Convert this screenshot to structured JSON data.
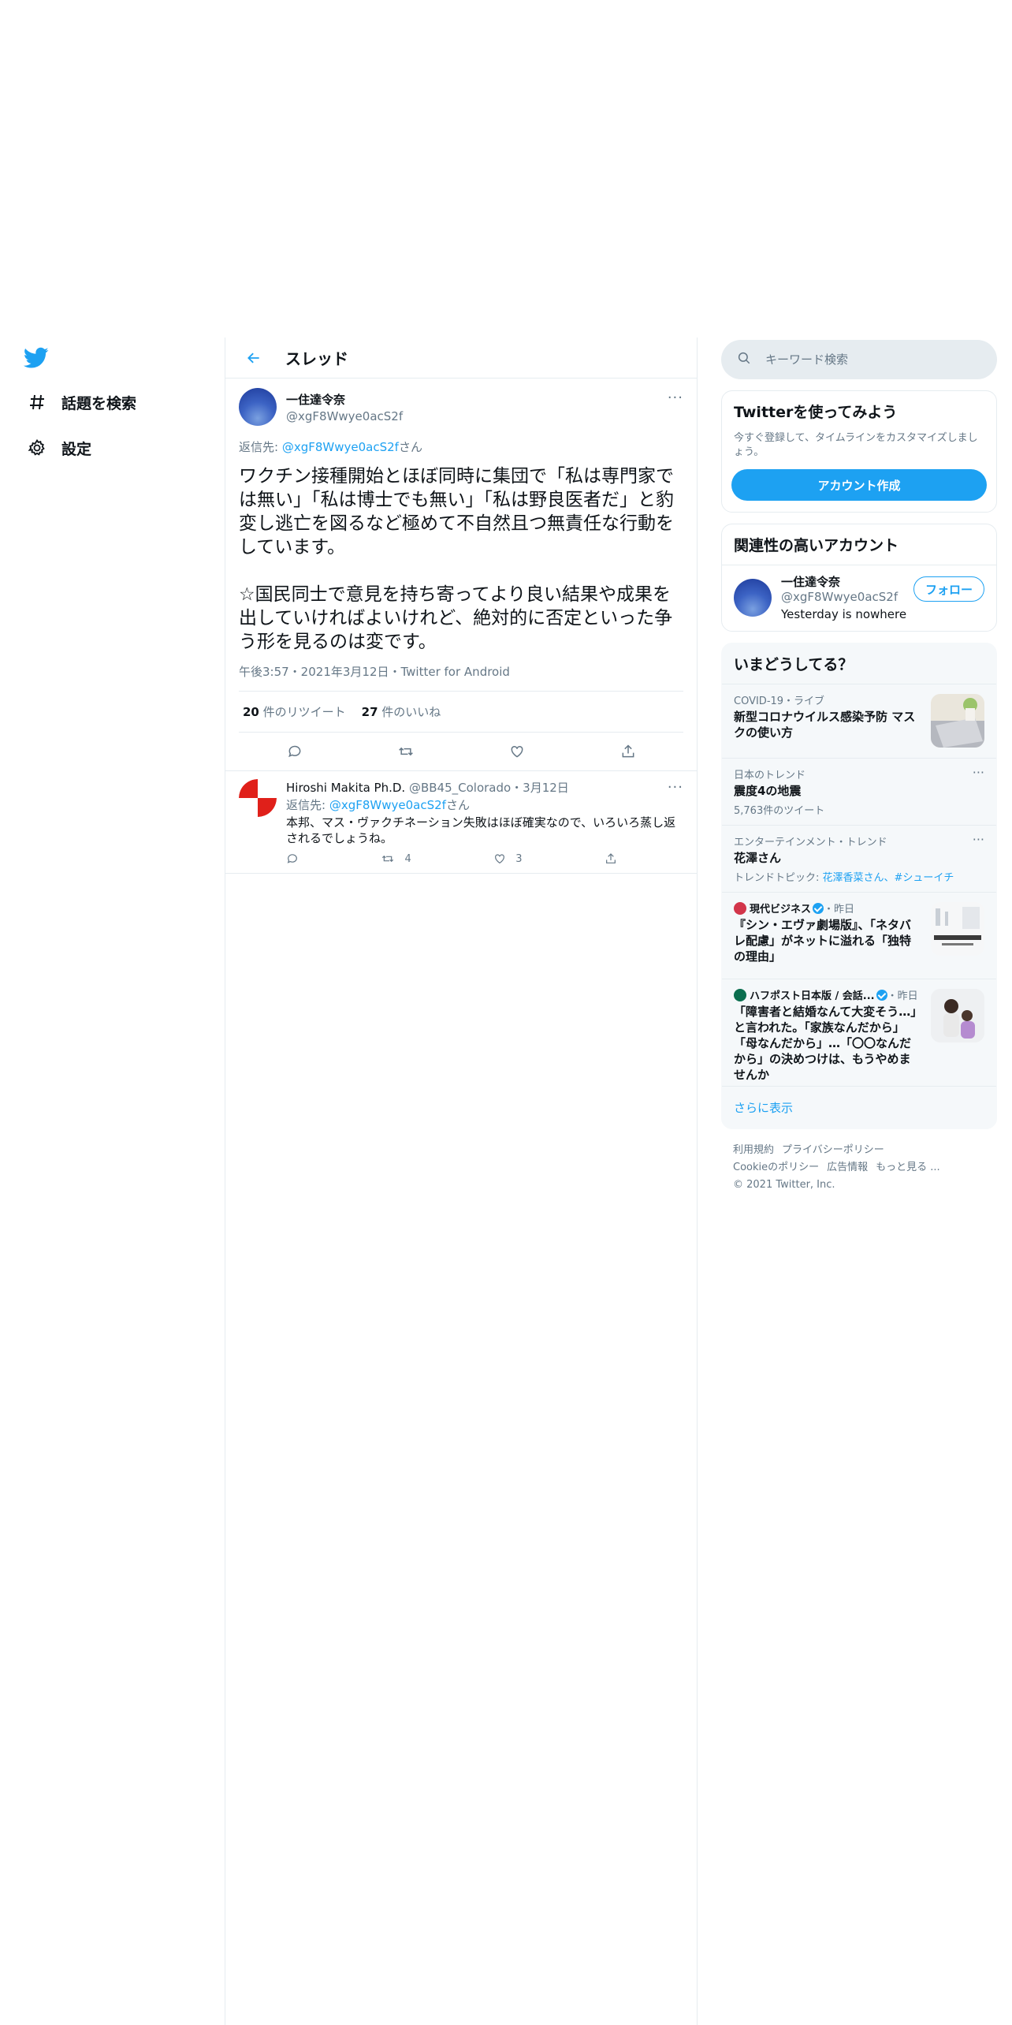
{
  "nav": {
    "items": [
      {
        "label": "話題を検索",
        "icon": "hashtag-icon"
      },
      {
        "label": "設定",
        "icon": "gear-icon"
      }
    ]
  },
  "header": {
    "title": "スレッド"
  },
  "tweet": {
    "name": "一住達令奈",
    "handle": "@xgF8Wwye0acS2f",
    "reply_prefix": "返信先: ",
    "reply_handle": "@xgF8Wwye0acS2f",
    "reply_suffix": "さん",
    "body": "ワクチン接種開始とほぼ同時に集団で「私は専門家では無い」「私は博士でも無い」「私は野良医者だ」と豹変し逃亡を図るなど極めて不自然且つ無責任な行動をしています。\n\n☆国民同士で意見を持ち寄ってより良い結果や成果を出していければよいけれど、絶対的に否定といった争う形を見るのは変です。",
    "meta": "午後3:57・2021年3月12日・Twitter for Android",
    "retweets": "20",
    "retweets_label": " 件のリツイート",
    "likes": "27",
    "likes_label": " 件のいいね"
  },
  "reply": {
    "name": "Hiroshi Makita Ph.D.",
    "handle_date": " @BB45_Colorado・3月12日",
    "reply_prefix": "返信先: ",
    "reply_handle": "@xgF8Wwye0acS2f",
    "reply_suffix": "さん",
    "text": "本邦、マス・ヴァクチネーション失敗はほぼ確実なので、いろいろ蒸し返されるでしょうね。",
    "retweets": "4",
    "likes": "3"
  },
  "search": {
    "placeholder": "キーワード検索"
  },
  "signup": {
    "title": "Twitterを使ってみよう",
    "desc": "今すぐ登録して、タイムラインをカスタマイズしましょう。",
    "button": "アカウント作成"
  },
  "related": {
    "title": "関連性の高いアカウント",
    "name": "一住達令奈",
    "handle": "@xgF8Wwye0acS2f",
    "bio": "Yesterday is nowhere",
    "follow": "フォロー"
  },
  "trends": {
    "title": "いまどうしてる？",
    "items": [
      {
        "ctx": "COVID-19・ライブ",
        "title": "新型コロナウイルス感染予防 マスクの使い方"
      },
      {
        "ctx": "日本のトレンド",
        "title": "震度4の地震",
        "sub": "5,763件のツイート"
      },
      {
        "ctx": "エンターテインメント・トレンド",
        "title": "花澤さん",
        "sub_prefix": "トレンドトピック: ",
        "sub_links": "花澤香菜さん、#シューイチ"
      },
      {
        "source": "現代ビジネス",
        "time": "・昨日",
        "title": "『シン・エヴァ劇場版』、「ネタバレ配慮」がネットに溢れる「独特の理由」"
      },
      {
        "source": "ハフポスト日本版 / 会話...",
        "time": "・昨日",
        "title": "「障害者と結婚なんて大変そう…」と言われた。「家族なんだから」「母なんだから」…「〇〇なんだから」の決めつけは、もうやめませんか"
      }
    ],
    "show_more": "さらに表示"
  },
  "footer": {
    "links1": [
      "利用規約",
      "プライバシーポリシー"
    ],
    "links2": [
      "Cookieのポリシー",
      "広告情報",
      "もっと見る ..."
    ],
    "copyright": "© 2021 Twitter, Inc."
  },
  "colors": {
    "accent": "#1da1f2",
    "secondary_text": "#657786",
    "border": "#e6ecf0"
  }
}
